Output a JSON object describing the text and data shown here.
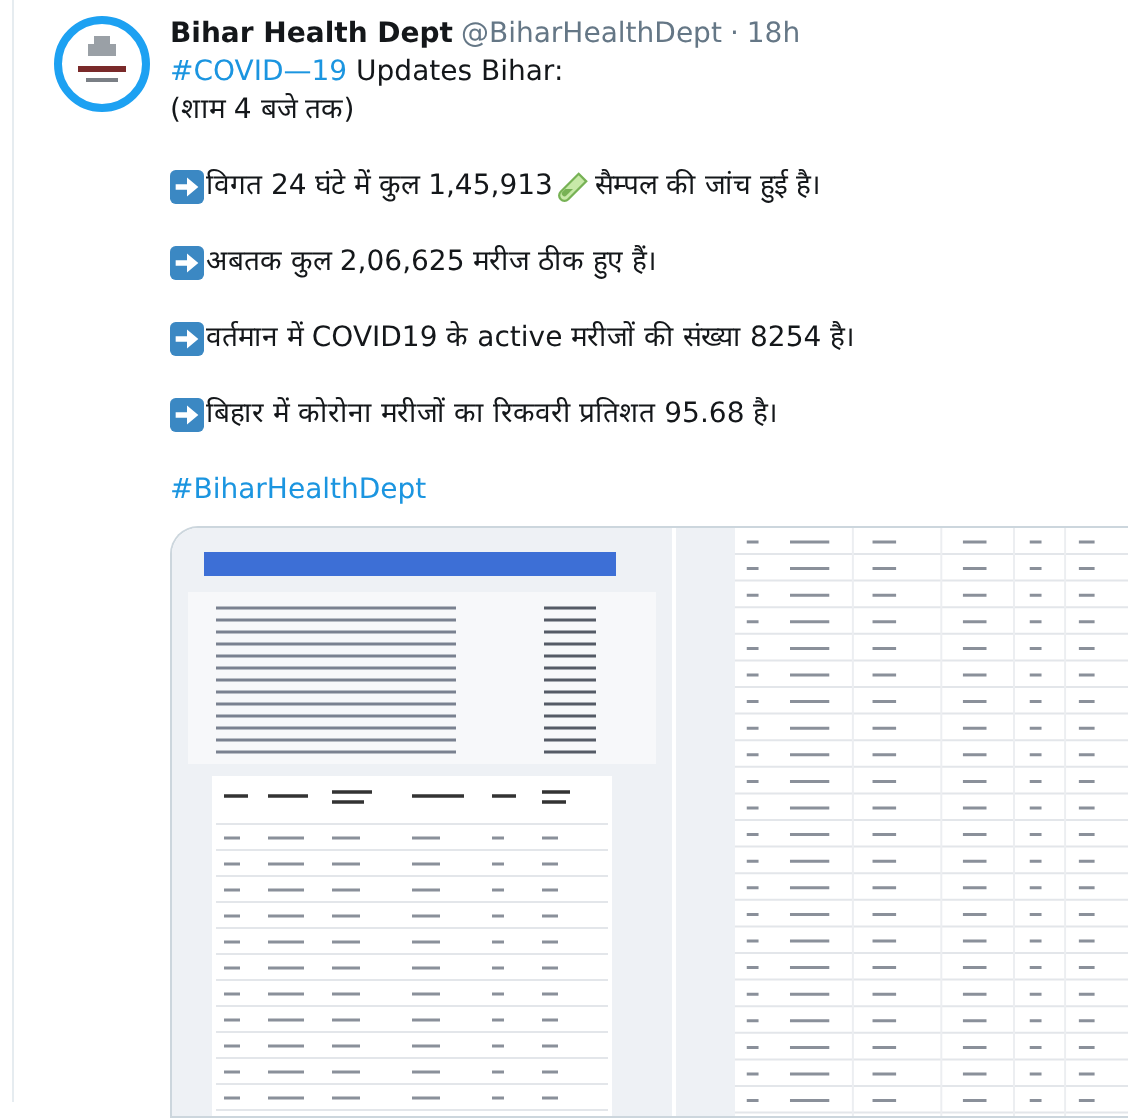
{
  "tweet": {
    "author": "Bihar Health Dept",
    "handle": "@BiharHealthDept",
    "separator": "·",
    "time": "18h",
    "hashtag": "#COVID—19",
    "title_rest": " Updates Bihar:",
    "subtitle": "(शाम 4 बजे तक)",
    "bullets": [
      {
        "segments": [
          "विगत 24 घंटे में कुल 1,45,913",
          "सैम्पल की जांच हुई है।"
        ]
      },
      {
        "segments": [
          "अबतक कुल 2,06,625 मरीज ठीक हुए हैं।"
        ]
      },
      {
        "segments": [
          " वर्तमान में COVID19 के active मरीजों की संख्या 8254 है।"
        ]
      },
      {
        "segments": [
          "बिहार में कोरोना मरीजों का रिकवरी प्रतिशत 95.68 है।"
        ]
      }
    ],
    "footer_hashtag": "#BiharHealthDept"
  }
}
